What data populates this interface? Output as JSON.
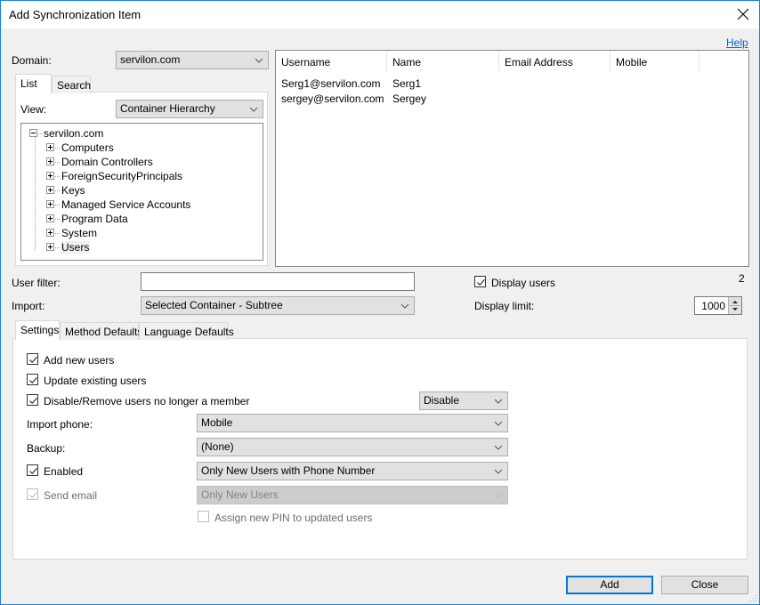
{
  "window": {
    "title": "Add Synchronization Item",
    "close_icon": "close-x-icon",
    "help_link": "Help"
  },
  "domain": {
    "label": "Domain:",
    "value": "servilon.com"
  },
  "left_tabs": [
    {
      "label": "List",
      "active": true
    },
    {
      "label": "Search",
      "active": false
    }
  ],
  "view": {
    "label": "View:",
    "value": "Container Hierarchy"
  },
  "tree": {
    "root": {
      "label": "servilon.com",
      "expanded": true
    },
    "children": [
      {
        "label": "Computers",
        "expanded": false,
        "selected": false
      },
      {
        "label": "Domain Controllers",
        "expanded": false,
        "selected": false
      },
      {
        "label": "ForeignSecurityPrincipals",
        "expanded": false,
        "selected": false
      },
      {
        "label": "Keys",
        "expanded": false,
        "selected": false
      },
      {
        "label": "Managed Service Accounts",
        "expanded": false,
        "selected": false
      },
      {
        "label": "Program Data",
        "expanded": false,
        "selected": false
      },
      {
        "label": "System",
        "expanded": false,
        "selected": false
      },
      {
        "label": "Users",
        "expanded": false,
        "selected": true
      }
    ]
  },
  "users_list": {
    "columns": [
      "Username",
      "Name",
      "Email Address",
      "Mobile"
    ],
    "rows": [
      [
        "Serg1@servilon.com",
        "Serg1",
        "",
        ""
      ],
      [
        "sergey@servilon.com",
        "Sergey",
        "",
        ""
      ]
    ],
    "count": "2"
  },
  "user_filter": {
    "label": "User filter:",
    "value": "",
    "placeholder": ""
  },
  "import": {
    "label": "Import:",
    "value": "Selected Container - Subtree"
  },
  "display_users": {
    "label": "Display users",
    "checked": true
  },
  "display_limit": {
    "label": "Display limit:",
    "value": "1000"
  },
  "bottom_tabs": [
    {
      "label": "Settings",
      "active": true
    },
    {
      "label": "Method Defaults",
      "active": false
    },
    {
      "label": "Language Defaults",
      "active": false
    }
  ],
  "settings": {
    "add_new_users": {
      "label": "Add new users",
      "checked": true
    },
    "update_existing_users": {
      "label": "Update existing users",
      "checked": true
    },
    "disable_remove": {
      "label": "Disable/Remove users no longer a member",
      "checked": true,
      "action_value": "Disable"
    },
    "import_phone": {
      "label": "Import phone:",
      "value": "Mobile"
    },
    "backup": {
      "label": "Backup:",
      "value": "(None)"
    },
    "enabled": {
      "label": "Enabled",
      "checked": true,
      "value": "Only New Users with Phone Number"
    },
    "send_email": {
      "label": "Send email",
      "checked": true,
      "disabled": true,
      "value": "Only New Users"
    },
    "assign_pin": {
      "label": "Assign new PIN to updated users",
      "checked": false,
      "disabled": true
    }
  },
  "buttons": {
    "add": "Add",
    "close": "Close"
  }
}
